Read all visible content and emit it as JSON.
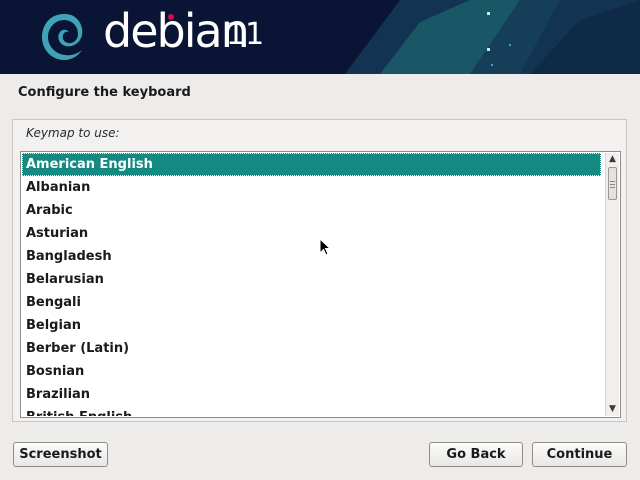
{
  "banner": {
    "logo_text": "debian",
    "version": "11",
    "accent_color": "#d70a53",
    "background_color": "#0a1434"
  },
  "page": {
    "title": "Configure the keyboard"
  },
  "keymap": {
    "label": "Keymap to use:",
    "selected": "American English",
    "items": [
      "American English",
      "Albanian",
      "Arabic",
      "Asturian",
      "Bangladesh",
      "Belarusian",
      "Bengali",
      "Belgian",
      "Berber (Latin)",
      "Bosnian",
      "Brazilian",
      "British English"
    ],
    "selection_color": "#148a82"
  },
  "buttons": {
    "screenshot": "Screenshot",
    "go_back": "Go Back",
    "continue": "Continue"
  },
  "icons": {
    "logo": "debian-swirl-icon",
    "scroll_up": "scroll-up-arrow-icon",
    "scroll_down": "scroll-down-arrow-icon",
    "cursor": "mouse-pointer-icon"
  }
}
